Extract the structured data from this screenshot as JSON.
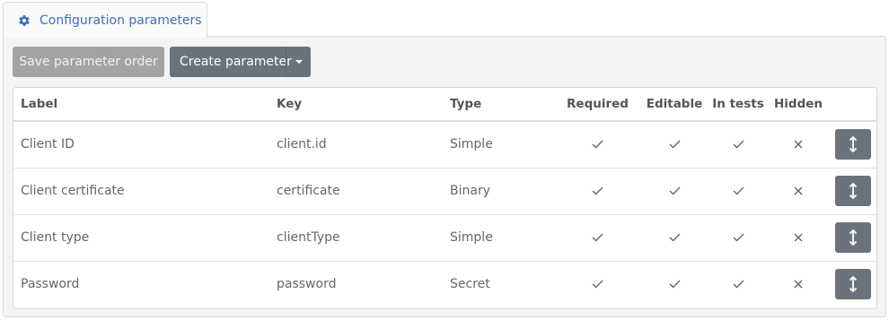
{
  "tab": {
    "label": "Configuration parameters",
    "icon": "gear-icon",
    "accent": "#3d6fb6"
  },
  "toolbar": {
    "save_label": "Save parameter order",
    "create_label": "Create parameter"
  },
  "table": {
    "headers": {
      "label": "Label",
      "key": "Key",
      "type": "Type",
      "required": "Required",
      "editable": "Editable",
      "in_tests": "In tests",
      "hidden": "Hidden"
    },
    "rows": [
      {
        "label": "Client ID",
        "key": "client.id",
        "type": "Simple",
        "required": true,
        "editable": true,
        "in_tests": true,
        "hidden": false
      },
      {
        "label": "Client certificate",
        "key": "certificate",
        "type": "Binary",
        "required": true,
        "editable": true,
        "in_tests": true,
        "hidden": false
      },
      {
        "label": "Client type",
        "key": "clientType",
        "type": "Simple",
        "required": true,
        "editable": true,
        "in_tests": true,
        "hidden": false
      },
      {
        "label": "Password",
        "key": "password",
        "type": "Secret",
        "required": true,
        "editable": true,
        "in_tests": true,
        "hidden": false
      }
    ]
  },
  "colors": {
    "button_dark": "#6a737b",
    "button_disabled": "#a3a3a3"
  }
}
